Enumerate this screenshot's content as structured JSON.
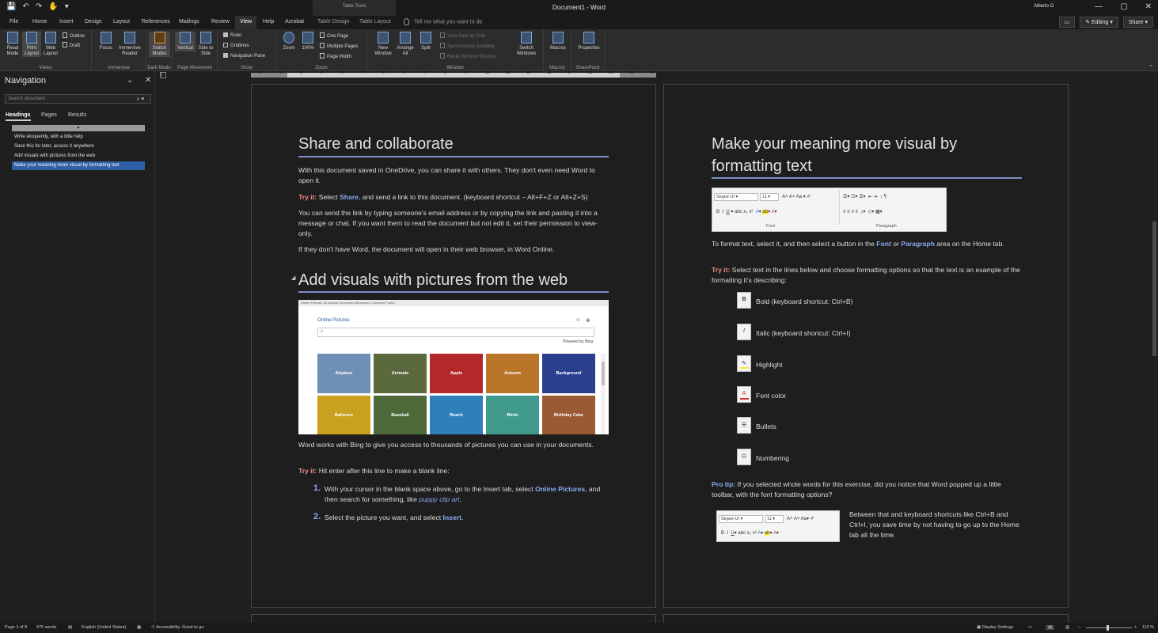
{
  "titlebar": {
    "title": "Document1  -  Word",
    "context_group": "Table Tools",
    "user": "Alberto G",
    "qat": [
      "💾",
      "↶",
      "↷",
      "✋",
      "▾"
    ],
    "window_controls": [
      "—",
      "▢",
      "✕"
    ]
  },
  "tabs": [
    {
      "label": "File"
    },
    {
      "label": "Home"
    },
    {
      "label": "Insert"
    },
    {
      "label": "Design"
    },
    {
      "label": "Layout"
    },
    {
      "label": "References"
    },
    {
      "label": "Mailings"
    },
    {
      "label": "Review"
    },
    {
      "label": "View"
    },
    {
      "label": "Help"
    },
    {
      "label": "Acrobat"
    },
    {
      "label": "Table Design"
    },
    {
      "label": "Table Layout"
    }
  ],
  "tell_me": "Tell me what you want to do",
  "editing_label": "Editing",
  "share_label": "Share",
  "ribbon": {
    "views": {
      "read_mode": "Read Mode",
      "print_layout": "Print Layout",
      "web_layout": "Web Layout",
      "outline": "Outline",
      "draft": "Draft",
      "label": "Views"
    },
    "immersive": {
      "focus": "Focus",
      "immersive_reader": "Immersive Reader",
      "label": "Immersive"
    },
    "dark_mode": {
      "switch_modes": "Switch Modes",
      "label": "Dark Mode"
    },
    "page_movement": {
      "vertical": "Vertical",
      "side_to_side": "Side to Side",
      "label": "Page Movement"
    },
    "show": {
      "ruler": "Ruler",
      "gridlines": "Gridlines",
      "navigation_pane": "Navigation Pane",
      "label": "Show"
    },
    "zoom": {
      "zoom": "Zoom",
      "hundred": "100%",
      "one_page": "One Page",
      "multiple_pages": "Multiple Pages",
      "page_width": "Page Width",
      "label": "Zoom"
    },
    "window": {
      "new_window": "New Window",
      "arrange_all": "Arrange All",
      "split": "Split",
      "view_side_by_side": "View Side by Side",
      "sync_scroll": "Synchronous Scrolling",
      "reset_pos": "Reset Window Position",
      "switch_windows": "Switch Windows",
      "label": "Window"
    },
    "macros": {
      "macros": "Macros",
      "label": "Macros"
    },
    "sharepoint": {
      "properties": "Properties",
      "label": "SharePoint"
    }
  },
  "ruler_numbers": [
    "2",
    "1",
    "1",
    "2",
    "3",
    "4",
    "5",
    "6",
    "7",
    "8",
    "9",
    "10",
    "11",
    "12",
    "13",
    "14",
    "15",
    "16",
    "18",
    "19"
  ],
  "navigation": {
    "title": "Navigation",
    "search_placeholder": "Search document",
    "tabs": [
      "Headings",
      "Pages",
      "Results"
    ],
    "collapse_marker": "▲",
    "items": [
      "Write eloquently, with a little help",
      "Save this for later, access it anywhere",
      "Add visuals with pictures from the web",
      "Make your meaning more visual by formatting text"
    ]
  },
  "page1": {
    "heading1": "Share and collaborate",
    "p1": "With this document saved in OneDrive, you can share it with others. They don't even need Word to open it.",
    "try1_label": "Try it:",
    "try1_a": " Select ",
    "try1_b": "Share",
    "try1_c": ", and send a link to this document. (keyboard shortcut – Alt+F+Z or Alt+Z+S)",
    "p2": "You can send the link by typing someone's email address or by copying the link and pasting it into a message or chat. If you want them to read the document but not edit it, set their permission to view-only.",
    "p3": "If they don't have Word, the document will open in their web browser, in Word Online.",
    "heading2": "Add visuals with pictures from the web",
    "dialog": {
      "topbar": "Online Pictures    3D Models    Screenshot                                   Bookmark                    Comment             Footer",
      "title": "Online Pictures",
      "powered": "Powered by  Bing",
      "thumbs": [
        {
          "label": "Airplane",
          "color": "#6f8fb4"
        },
        {
          "label": "Animals",
          "color": "#5a6a3c"
        },
        {
          "label": "Apple",
          "color": "#b3282a"
        },
        {
          "label": "Autumn",
          "color": "#b9762a"
        },
        {
          "label": "Background",
          "color": "#2b3f8f"
        },
        {
          "label": "Balloons",
          "color": "#c9a11f"
        },
        {
          "label": "Baseball",
          "color": "#4f6a3a"
        },
        {
          "label": "Beach",
          "color": "#2f7fb8"
        },
        {
          "label": "Birds",
          "color": "#3f9a8c"
        },
        {
          "label": "Birthday Cake",
          "color": "#9a5a34"
        }
      ]
    },
    "p4": "Word works with Bing to give you access to thousands of pictures you can use in your documents.",
    "try2_label": "Try it:",
    "try2_text": " Hit enter after this line to make a blank line:",
    "step1_num": "1.",
    "step1_a": "With your cursor in the blank space above, go to the Insert tab, select ",
    "step1_b": "Online Pictures",
    "step1_c": ", and then search for something, like ",
    "step1_d": "puppy clip art",
    "step1_e": ".",
    "step2_num": "2.",
    "step2_a": "Select the picture you want, and select ",
    "step2_b": "Insert",
    "step2_c": "."
  },
  "page2": {
    "heading": "Make your meaning more visual by formatting text",
    "toolbar": {
      "font": "Segoe UI",
      "size": "11",
      "font_label": "Font",
      "para_label": "Paragraph"
    },
    "p1_a": "To format text, select it, and then select a button in the ",
    "p1_b": "Font",
    "p1_c": " or ",
    "p1_d": "Paragraph",
    "p1_e": " area on the Home tab.",
    "try_label": "Try it:",
    "try_text": " Select text in the lines below and choose formatting options so that the text is an example of the formatting it's describing:",
    "items": [
      {
        "glyph": "B",
        "label": "Bold (keyboard shortcut: Ctrl+B)"
      },
      {
        "glyph": "I",
        "label": "Italic (keyboard shortcut: Ctrl+I)"
      },
      {
        "glyph": "✎",
        "label": "Highlight"
      },
      {
        "glyph": "A",
        "label": "Font color"
      },
      {
        "glyph": "☰",
        "label": "Bullets"
      },
      {
        "glyph": "☷",
        "label": "Numbering"
      }
    ],
    "protip_label": "Pro tip:",
    "protip_text": " If you selected whole words for this exercise, did you notice that Word popped up a little toolbar, with the font formatting options?",
    "mini": {
      "font": "Segoe UI",
      "size": "11"
    },
    "side_text": "Between that and keyboard shortcuts like Ctrl+B and Ctrl+I, you save time by not having to go up to the Home tab all the time."
  },
  "status": {
    "page": "Page 1 of 8",
    "words": "975 words",
    "language": "English (United States)",
    "accessibility": "Accessibility: Good to go",
    "display_settings": "Display Settings",
    "zoom": "110 %"
  },
  "colors": {
    "accent": "#2f5fa7",
    "tryit": "#f08b8b",
    "link": "#8aa9f2",
    "heading_rule": "#7c8fc9"
  }
}
